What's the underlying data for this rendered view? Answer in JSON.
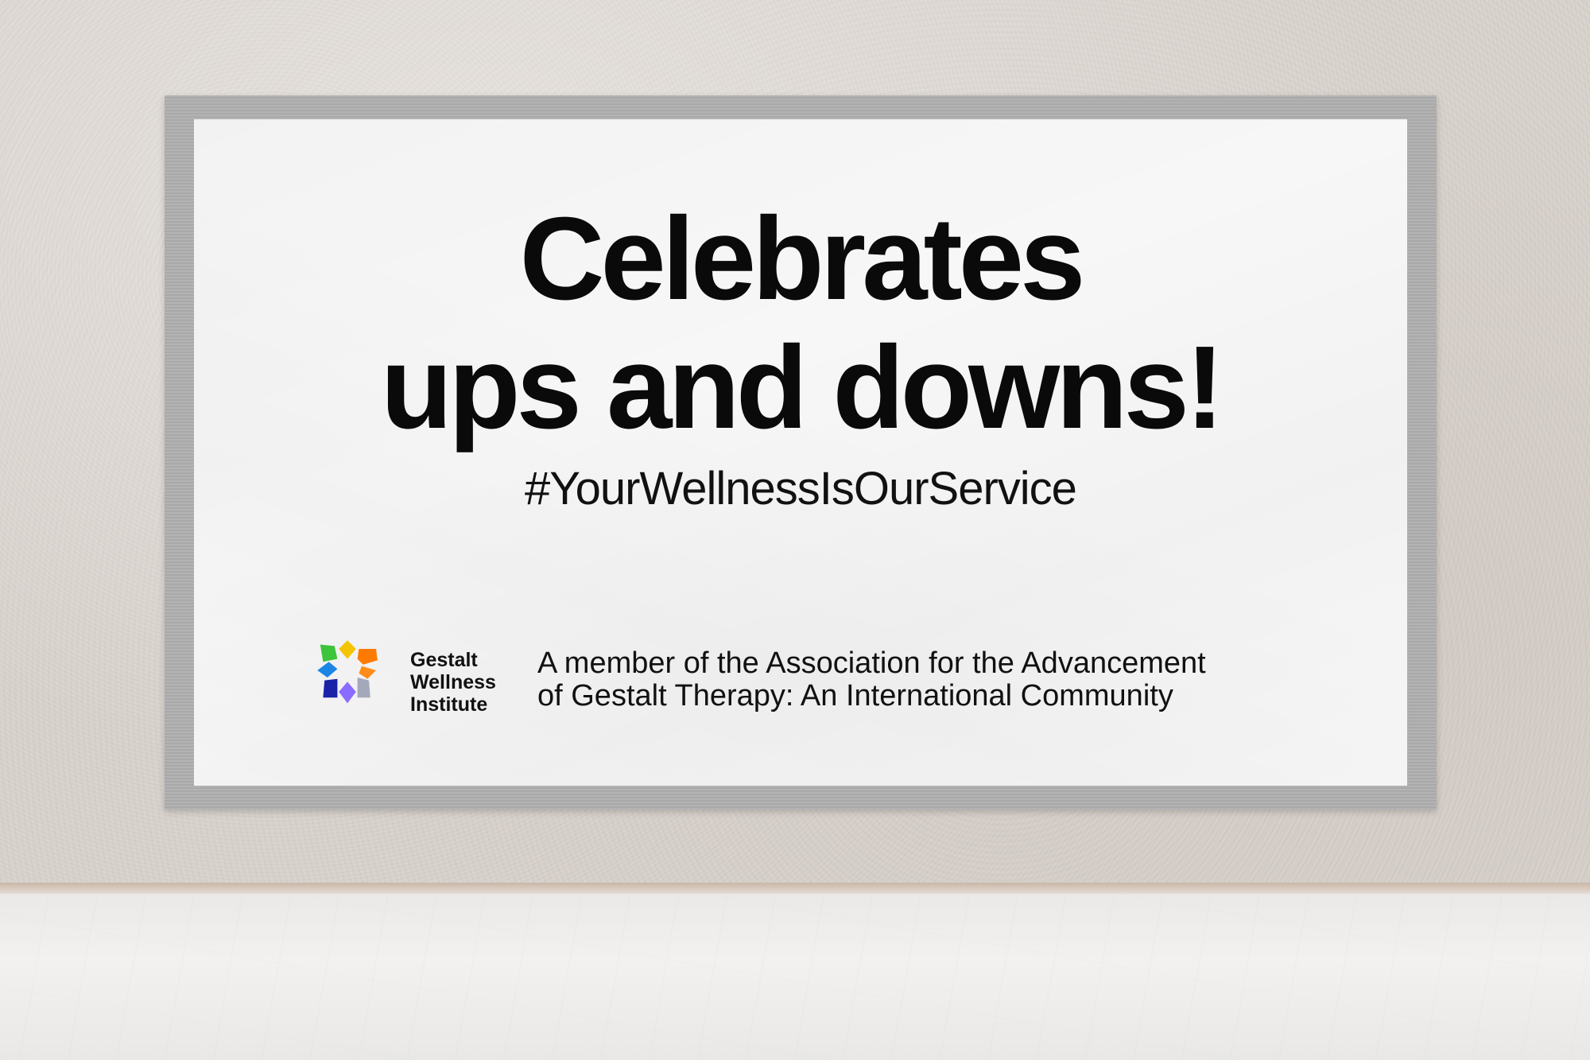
{
  "poster": {
    "headline_line1": "Celebrates",
    "headline_line2": "ups and downs!",
    "hashtag": "#YourWellnessIsOurService",
    "brand": {
      "line1": "Gestalt",
      "line2": "Wellness",
      "line3": "Institute",
      "logo_icon": "pinwheel-logo-icon",
      "logo_colors": [
        "#f4c400",
        "#ff7a00",
        "#9aa0b4",
        "#8a6cff",
        "#1a22a8",
        "#1c86e6",
        "#3cc43c"
      ]
    },
    "membership_line1": "A member of the Association for the Advancement",
    "membership_line2": "of Gestalt Therapy: An International Community"
  },
  "scene": {
    "wall_color": "#d8d2cc",
    "frame_color": "#adadad",
    "poster_color": "#f7f7f7",
    "floor_color": "#eeeeec"
  }
}
